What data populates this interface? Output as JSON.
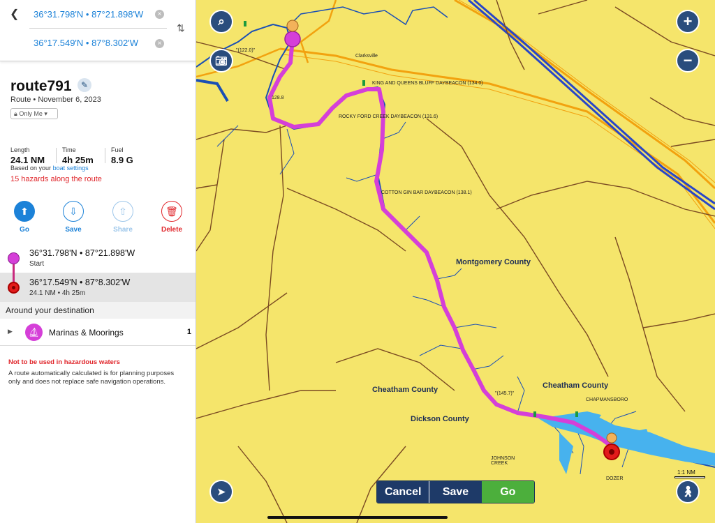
{
  "search": {
    "from": "36°31.798'N • 87°21.898'W",
    "to": "36°17.549'N • 87°8.302'W"
  },
  "route": {
    "title": "route791",
    "subtitle": "Route • November 6, 2023",
    "visibility": "Only Me"
  },
  "stats": {
    "length_label": "Length",
    "length_value": "24.1 NM",
    "time_label": "Time",
    "time_value": "4h 25m",
    "fuel_label": "Fuel",
    "fuel_value": "8.9 G",
    "based_on": "Based on your",
    "boat_settings": "boat settings",
    "hazards": "15 hazards along the route"
  },
  "actions": {
    "go": "Go",
    "save": "Save",
    "share": "Share",
    "delete": "Delete"
  },
  "waypoints": {
    "start_coord": "36°31.798'N • 87°21.898'W",
    "start_label": "Start",
    "end_coord": "36°17.549'N • 87°8.302'W",
    "end_sub": "24.1 NM • 4h 25m"
  },
  "around": {
    "header": "Around your destination",
    "marinas_label": "Marinas & Moorings",
    "marinas_count": "1"
  },
  "warning": {
    "title": "Not to be used in hazardous waters",
    "text": "A route automatically calculated is for planning purposes only and does not replace safe navigation operations."
  },
  "map_labels": {
    "clarksville": "Clarksville",
    "king_queens": "KING AND QUEENS BLUFF DAYBEACON (134.0)",
    "rocky_ford": "ROCKY FORD CREEK DAYBEACON (131.6)",
    "cotton_gin": "COTTON GIN BAR DAYBEACON (138.1)",
    "mile_122": "\"(122.0)\"",
    "mile_128": "128.8",
    "mile_145": "\"(145.7)\"",
    "chapmansboro": "CHAPMANSBORO",
    "johnson_creek": "JOHNSON CREEK",
    "dozer": "DOZER",
    "montgomery": "Montgomery County",
    "cheatham_left": "Cheatham County",
    "cheatham_right": "Cheatham County",
    "dickson": "Dickson County",
    "scale": "1:1 NM"
  },
  "bottom_bar": {
    "cancel": "Cancel",
    "save": "Save",
    "go": "Go"
  },
  "colors": {
    "route": "#d53fd8",
    "map_land": "#f5e56b",
    "button_navy": "#2a4d7d",
    "go_green": "#4caf3c",
    "link_blue": "#1c82d8",
    "hazard_red": "#e0262b"
  }
}
